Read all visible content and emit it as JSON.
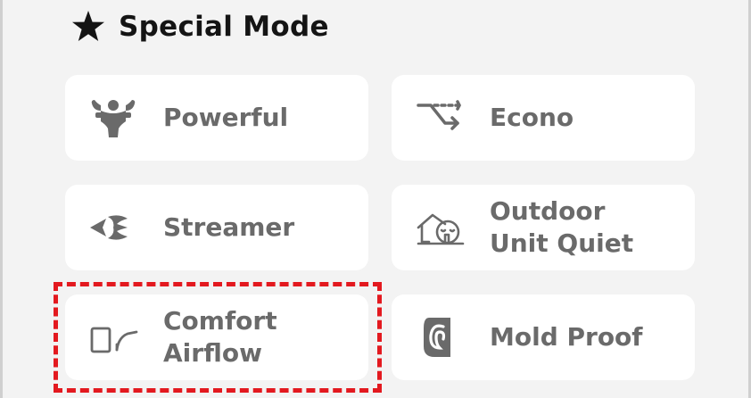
{
  "header": {
    "icon": "star-icon",
    "title": "Special Mode"
  },
  "modes": [
    {
      "icon": "powerful-muscle-icon",
      "label": "Powerful"
    },
    {
      "icon": "econo-icon",
      "label": "Econo"
    },
    {
      "icon": "streamer-icon",
      "label": "Streamer"
    },
    {
      "icon": "outdoor-unit-quiet-icon",
      "label": "Outdoor\nUnit Quiet"
    },
    {
      "icon": "comfort-airflow-icon",
      "label": "Comfort\nAirflow"
    },
    {
      "icon": "mold-proof-icon",
      "label": "Mold Proof"
    }
  ],
  "highlighted_mode": "Comfort Airflow",
  "colors": {
    "background": "#f3f3f3",
    "card": "#ffffff",
    "label": "#6a6a6a",
    "title": "#141414",
    "highlight": "#e3191f"
  }
}
